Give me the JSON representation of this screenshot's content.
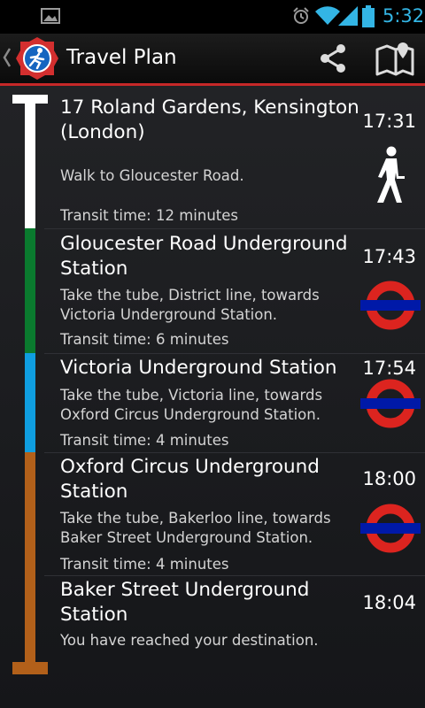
{
  "status_bar": {
    "time": "5:32",
    "icons": [
      "gallery-icon",
      "alarm-icon",
      "wifi-icon",
      "signal-icon",
      "battery-icon"
    ],
    "accent_color": "#33b5e5"
  },
  "action_bar": {
    "title": "Travel Plan",
    "icons": [
      "up-chevron-icon",
      "app-logo-icon",
      "share-icon",
      "map-icon"
    ]
  },
  "legs": [
    {
      "title": "17 Roland Gardens, Kensington (London)",
      "time": "17:31",
      "description": "Walk to Gloucester Road.",
      "transit": "Transit time: 12 minutes",
      "mode_icon": "walk-icon",
      "line_color": "#ffffff"
    },
    {
      "title": "Gloucester Road Underground Station",
      "time": "17:43",
      "description": "Take the tube,  District line, towards Victoria Underground Station.",
      "transit": "Transit time: 6 minutes",
      "mode_icon": "underground-roundel-icon",
      "line_color": "#0a7a2e"
    },
    {
      "title": "Victoria Underground Station",
      "time": "17:54",
      "description": "Take the tube,  Victoria line, towards Oxford Circus Underground Station.",
      "transit": "Transit time: 4 minutes",
      "mode_icon": "underground-roundel-icon",
      "line_color": "#0f9ee0"
    },
    {
      "title": "Oxford Circus Underground Station",
      "time": "18:00",
      "description": "Take the tube,  Bakerloo line, towards Baker Street Underground Station.",
      "transit": "Transit time: 4 minutes",
      "mode_icon": "underground-roundel-icon",
      "line_color": "#b2601a"
    },
    {
      "title": "Baker Street Underground Station",
      "time": "18:04",
      "description": "You have reached your destination.",
      "line_color": "#b2601a"
    }
  ]
}
